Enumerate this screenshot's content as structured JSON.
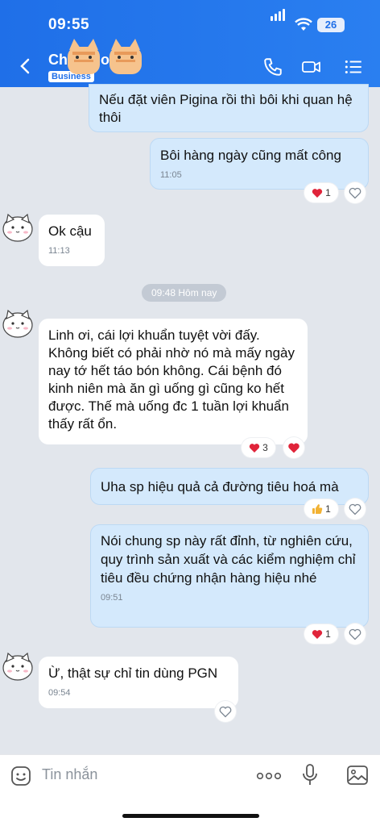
{
  "status_bar": {
    "time": "09:55",
    "battery": "26"
  },
  "header": {
    "title": "Chị ... go",
    "badge": "Business"
  },
  "messages": [
    {
      "direction": "outgoing",
      "text": "Nếu đặt viên Pigina rồi thì bôi khi quan hệ thôi"
    },
    {
      "direction": "outgoing",
      "text": "Bôi hàng ngày cũng mất công",
      "time": "11:05",
      "reaction_count": "1"
    },
    {
      "direction": "incoming",
      "text": "Ok cậu",
      "time": "11:13"
    },
    {
      "direction": "incoming",
      "text": "Linh ơi, cái lợi khuẩn tuyệt vời đấy. Không biết có phải nhờ nó mà mấy ngày nay tớ hết táo bón không. Cái bệnh đó kinh niên mà ăn gì uống gì cũng ko hết được. Thế mà uống đc 1 tuần lợi khuẩn thấy rất ổn.",
      "reaction_count": "3"
    },
    {
      "direction": "outgoing",
      "text": "Uha sp hiệu quả cả đường tiêu hoá mà",
      "reaction_count": "1"
    },
    {
      "direction": "outgoing",
      "text": "Nói chung sp này rất đỉnh, từ nghiên cứu, quy trình sản xuất và các kiểm nghiệm chỉ tiêu đều chứng nhận hàng hiệu nhé",
      "time": "09:51",
      "reaction_count": "1"
    },
    {
      "direction": "incoming",
      "text": "Ừ, thật sự chỉ tin dùng PGN",
      "time": "09:54"
    }
  ],
  "date_separator": "09:48 Hôm nay",
  "composer": {
    "placeholder": "Tin nhắn"
  },
  "colors": {
    "header": "#1f6fe8",
    "outgoing_bubble": "#d4e9fc",
    "incoming_bubble": "#ffffff",
    "heart": "#e0243a"
  }
}
